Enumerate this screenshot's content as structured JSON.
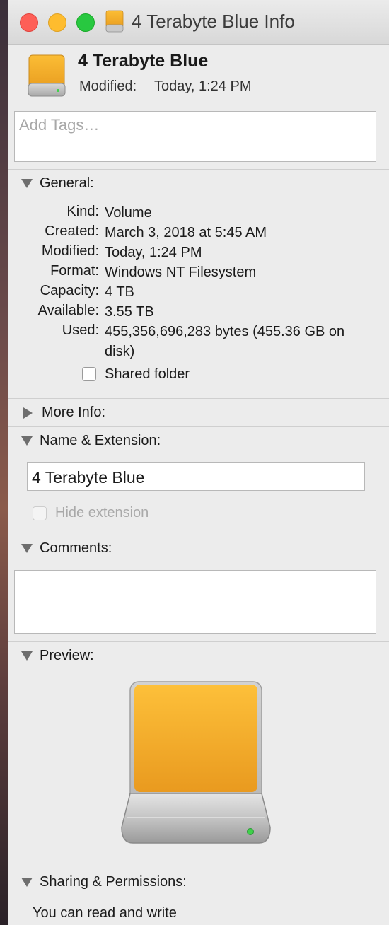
{
  "window": {
    "title": "4 Terabyte Blue Info"
  },
  "header": {
    "name": "4 Terabyte Blue",
    "modified_label": "Modified:",
    "modified_value": "Today, 1:24 PM",
    "icon": "external-drive-icon"
  },
  "tags": {
    "placeholder": "Add Tags…"
  },
  "general": {
    "heading": "General:",
    "rows": [
      {
        "key": "Kind:",
        "value": "Volume"
      },
      {
        "key": "Created:",
        "value": "March 3, 2018 at 5:45 AM"
      },
      {
        "key": "Modified:",
        "value": "Today, 1:24 PM"
      },
      {
        "key": "Format:",
        "value": "Windows NT Filesystem"
      },
      {
        "key": "Capacity:",
        "value": "4 TB"
      },
      {
        "key": "Available:",
        "value": "3.55 TB"
      },
      {
        "key": "Used:",
        "value": "455,356,696,283 bytes (455.36 GB on disk)"
      }
    ],
    "shared_folder_label": "Shared folder",
    "shared_folder_checked": false
  },
  "more_info": {
    "heading": "More Info:"
  },
  "name_extension": {
    "heading": "Name & Extension:",
    "value": "4 Terabyte Blue",
    "hide_extension_label": "Hide extension",
    "hide_extension_checked": false
  },
  "comments": {
    "heading": "Comments:",
    "value": ""
  },
  "preview": {
    "heading": "Preview:"
  },
  "sharing": {
    "heading": "Sharing & Permissions:",
    "text": "You can read and write"
  },
  "colors": {
    "drive_top": "#fbbd35",
    "drive_bottom": "#e99d20",
    "status_led": "#3fd14a"
  }
}
